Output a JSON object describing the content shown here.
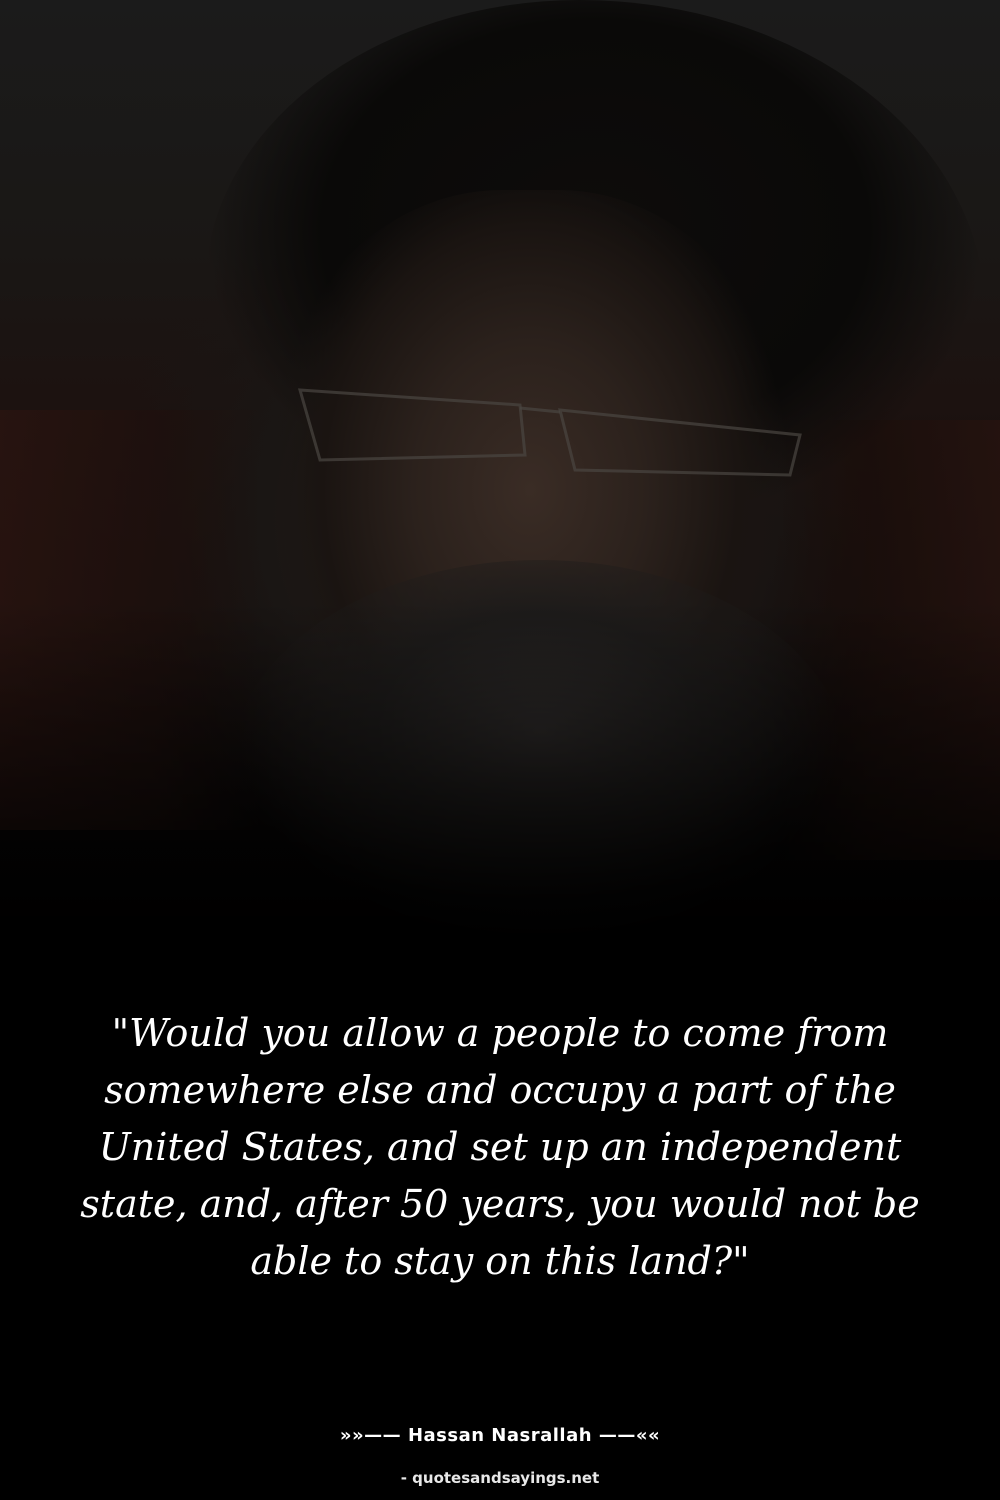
{
  "quote": {
    "text": "\"Would you allow a people to come from somewhere else and occupy a part of the United States, and set up an independent state, and, after 50 years, you would not be able to stay on this land?\""
  },
  "attribution": {
    "prefix": "»»—— ",
    "author": "Hassan Nasrallah",
    "suffix": " ——««"
  },
  "source": {
    "text": "- quotesandsayings.net"
  },
  "colors": {
    "background": "#000000",
    "text": "#ffffff"
  }
}
